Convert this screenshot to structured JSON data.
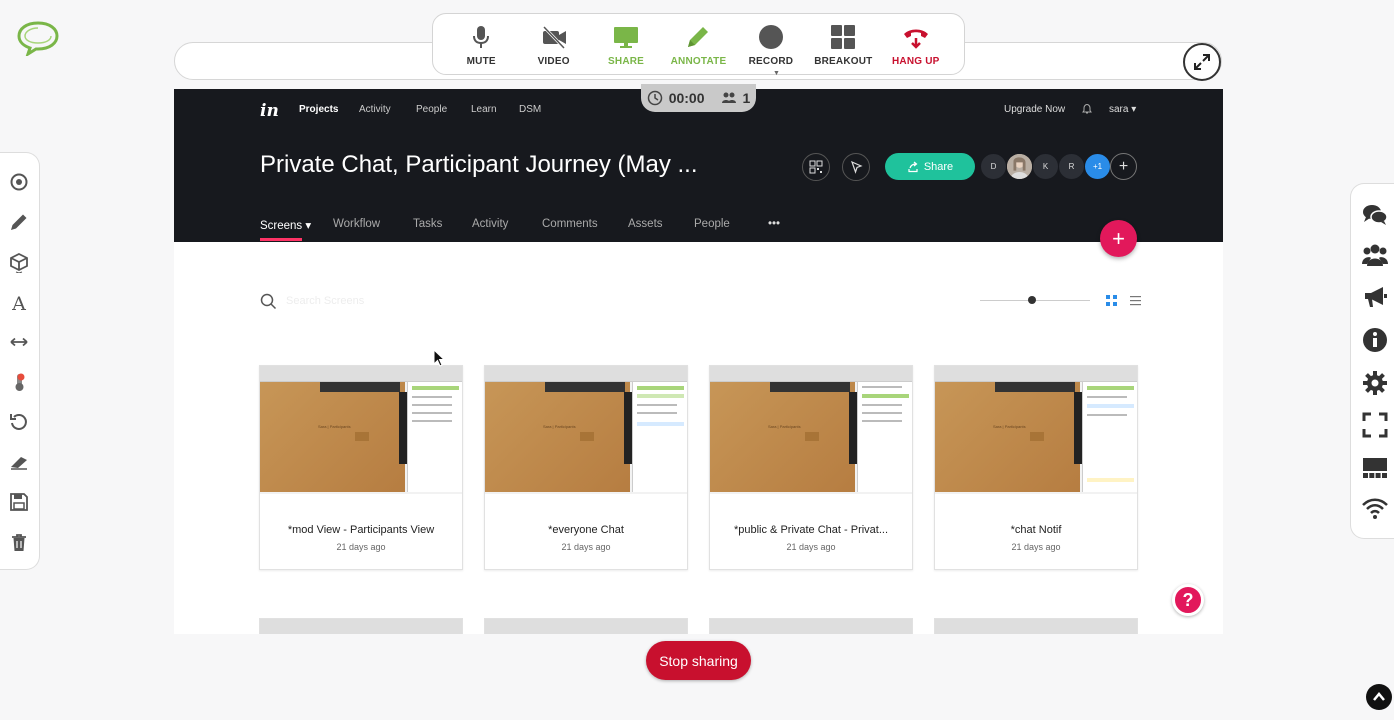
{
  "toolbar": {
    "mute": "MUTE",
    "video": "VIDEO",
    "share": "SHARE",
    "annotate": "ANNOTATE",
    "record": "RECORD",
    "breakout": "BREAKOUT",
    "hangup": "HANG UP"
  },
  "timer": {
    "time": "00:00",
    "participants": "1"
  },
  "invision": {
    "logo": "in",
    "nav": [
      "Projects",
      "Activity",
      "People",
      "Learn",
      "DSM"
    ],
    "upgrade": "Upgrade Now",
    "user": "sara ▾",
    "title": "Private Chat, Participant Journey (May ...",
    "share_label": "Share",
    "avatars": [
      "D",
      "",
      "K",
      "R",
      "+1"
    ],
    "subnav": [
      "Screens ▾",
      "Workflow",
      "Tasks",
      "Activity",
      "Comments",
      "Assets",
      "People",
      "•••"
    ],
    "search_placeholder": "Search Screens"
  },
  "cards": [
    {
      "name": "*mod View - Participants View",
      "age": "21 days ago"
    },
    {
      "name": "*everyone Chat",
      "age": "21 days ago"
    },
    {
      "name": "*public & Private Chat - Privat...",
      "age": "21 days ago"
    },
    {
      "name": "*chat Notif",
      "age": "21 days ago"
    }
  ],
  "thumb_caption": "Sara | Participants",
  "stop_sharing": "Stop sharing",
  "colors": {
    "green": "#7ab648",
    "red": "#c8102e",
    "invision_pink": "#e2185b",
    "invision_share": "#1fc29c"
  }
}
